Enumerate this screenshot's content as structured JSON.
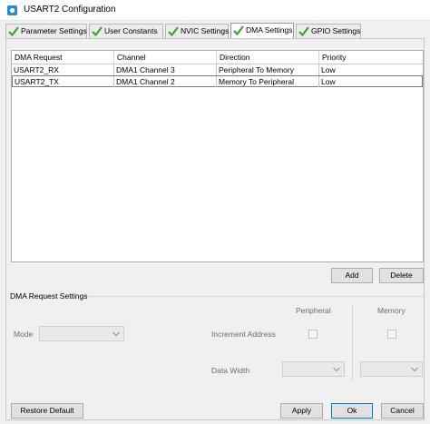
{
  "window": {
    "title": "USART2 Configuration"
  },
  "tabs": [
    {
      "label": "Parameter Settings"
    },
    {
      "label": "User Constants"
    },
    {
      "label": "NVIC Settings"
    },
    {
      "label": "DMA Settings",
      "active": true
    },
    {
      "label": "GPIO Settings"
    }
  ],
  "table": {
    "columns": [
      "DMA Request",
      "Channel",
      "Direction",
      "Priority"
    ],
    "rows": [
      [
        "USART2_RX",
        "DMA1 Channel 3",
        "Peripheral To Memory",
        "Low"
      ],
      [
        "USART2_TX",
        "DMA1 Channel 2",
        "Memory To Peripheral",
        "Low"
      ]
    ]
  },
  "buttons": {
    "add": "Add",
    "delete": "Delete",
    "restore_default": "Restore Default",
    "apply": "Apply",
    "ok": "Ok",
    "cancel": "Cancel"
  },
  "settings": {
    "section_label": "DMA Request Settings",
    "peripheral_header": "Peripheral",
    "memory_header": "Memory",
    "mode_label": "Mode",
    "increment_address_label": "Increment Address",
    "data_width_label": "Data Width"
  },
  "colors": {
    "check_green": "#3aa335",
    "focus_blue": "#0078d7",
    "icon_blue": "#2a8ad4"
  }
}
